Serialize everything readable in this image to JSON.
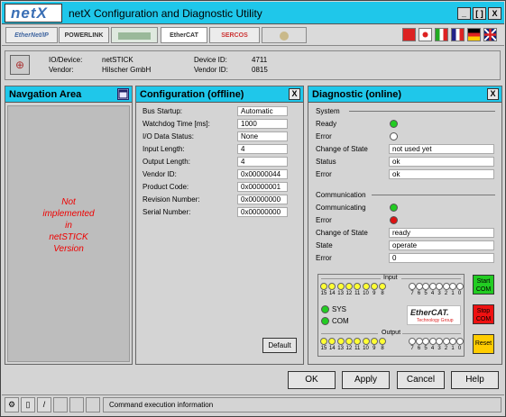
{
  "app": {
    "logo_text": "netX",
    "title": "netX Configuration and Diagnostic Utility",
    "window_buttons": [
      "_",
      "[ ]",
      "X"
    ]
  },
  "protocols": [
    "EtherNet/IP",
    "POWERLINK",
    "EtherCAT",
    "SERCOS"
  ],
  "device": {
    "io_device_label": "IO/Device:",
    "io_device_value": "netSTICK",
    "vendor_label": "Vendor:",
    "vendor_value": "Hilscher GmbH",
    "device_id_label": "Device ID:",
    "device_id_value": "4711",
    "vendor_id_label": "Vendor ID:",
    "vendor_id_value": "0815"
  },
  "nav": {
    "title": "Navgation Area",
    "not_implemented": [
      "Not",
      "implemented",
      "in",
      "netSTICK",
      "Version"
    ]
  },
  "config": {
    "title": "Configuration (offline)",
    "close": "X",
    "fields": [
      {
        "label": "Bus Startup:",
        "value": "Automatic"
      },
      {
        "label": "Watchdog Time [ms]:",
        "value": "1000"
      },
      {
        "label": "I/O Data Status:",
        "value": "None"
      },
      {
        "label": "Input Length:",
        "value": "4"
      },
      {
        "label": "Output Length:",
        "value": "4"
      },
      {
        "label": "Vendor ID:",
        "value": "0x00000044"
      },
      {
        "label": "Product Code:",
        "value": "0x00000001"
      },
      {
        "label": "Revision Number:",
        "value": "0x00000000"
      },
      {
        "label": "Serial Number:",
        "value": "0x00000000"
      }
    ],
    "default_button": "Default"
  },
  "diag": {
    "title": "Diagnostic (online)",
    "close": "X",
    "system": {
      "heading": "System",
      "ready_label": "Ready",
      "error_label": "Error",
      "change_label": "Change of State",
      "change_value": "not used yet",
      "status_label": "Status",
      "status_value": "ok",
      "error2_label": "Error",
      "error2_value": "ok"
    },
    "communication": {
      "heading": "Communication",
      "communicating_label": "Communicating",
      "error_label": "Error",
      "change_label": "Change of State",
      "change_value": "ready",
      "state_label": "State",
      "state_value": "operate",
      "error2_label": "Error",
      "error2_value": "0"
    },
    "ethercat": {
      "input_label": "Input",
      "output_label": "Output",
      "bits_high": [
        "15",
        "14",
        "13",
        "12",
        "11",
        "10",
        "9",
        "8"
      ],
      "bits_low": [
        "7",
        "6",
        "5",
        "4",
        "3",
        "2",
        "1",
        "0"
      ],
      "sys_label": "SYS",
      "com_label": "COM",
      "logo_text": "EtherCAT.",
      "logo_sub": "Technology Group",
      "start_com": "Start COM",
      "stop_com": "Stop COM",
      "reset": "Reset"
    }
  },
  "buttons": {
    "ok": "OK",
    "apply": "Apply",
    "cancel": "Cancel",
    "help": "Help"
  },
  "status_text": "Command execution information",
  "colors": {
    "accent": "#1fc7ea",
    "led_green": "#22cc22",
    "led_red": "#dd1111",
    "led_yellow": "#ffff33",
    "btn_green": "#22cc22",
    "btn_red": "#ee1111",
    "btn_yellow": "#ffcc00"
  }
}
